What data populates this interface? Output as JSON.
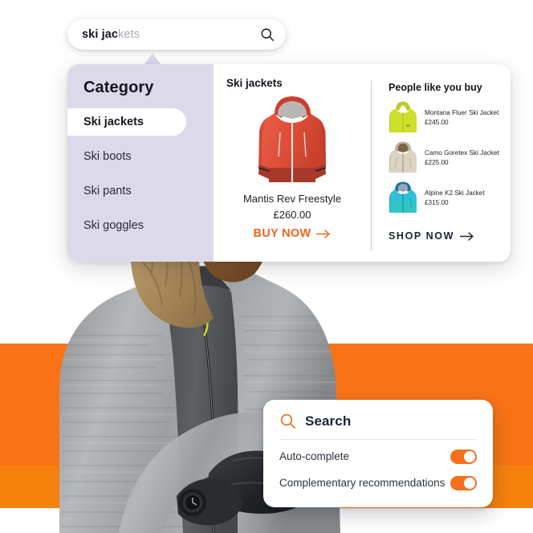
{
  "search_bar": {
    "typed_text": "ski jac",
    "suggested_suffix": "kets",
    "full_value": "ski jackets",
    "placeholder": "Search",
    "icon": "search-icon"
  },
  "results_panel": {
    "sidebar": {
      "title": "Category",
      "items": [
        {
          "label": "Ski jackets",
          "selected": true
        },
        {
          "label": "Ski boots",
          "selected": false
        },
        {
          "label": "Ski pants",
          "selected": false
        },
        {
          "label": "Ski goggles",
          "selected": false
        }
      ]
    },
    "main": {
      "heading": "Ski jackets",
      "product": {
        "name": "Mantis Rev Freestyle",
        "price": "£260.00",
        "image_alt": "red ski jacket",
        "cta": "BUY NOW",
        "cta_icon": "arrow-right-icon"
      }
    },
    "recommendations": {
      "heading": "People like you buy",
      "items": [
        {
          "name": "Montana Fluer Ski Jacket",
          "price": "£245.00",
          "color": "#CEE02A"
        },
        {
          "name": "Camo Goretex Ski Jacket",
          "price": "£225.00",
          "color": "#D9D0BE"
        },
        {
          "name": "Alpine K2 Ski Jacket",
          "price": "£315.00",
          "color": "#2EC0D8"
        }
      ],
      "cta": "SHOP  NOW",
      "cta_icon": "arrow-right-icon"
    }
  },
  "settings_card": {
    "icon": "search-icon",
    "title": "Search",
    "options": [
      {
        "label": "Auto-complete",
        "enabled": true
      },
      {
        "label": "Complementary recommendations",
        "enabled": true
      }
    ]
  },
  "colors": {
    "accent_orange": "#F2711C",
    "band_orange": "#F97316",
    "sidebar_lavender": "#DCDAEA",
    "text_dark": "#15161D"
  }
}
